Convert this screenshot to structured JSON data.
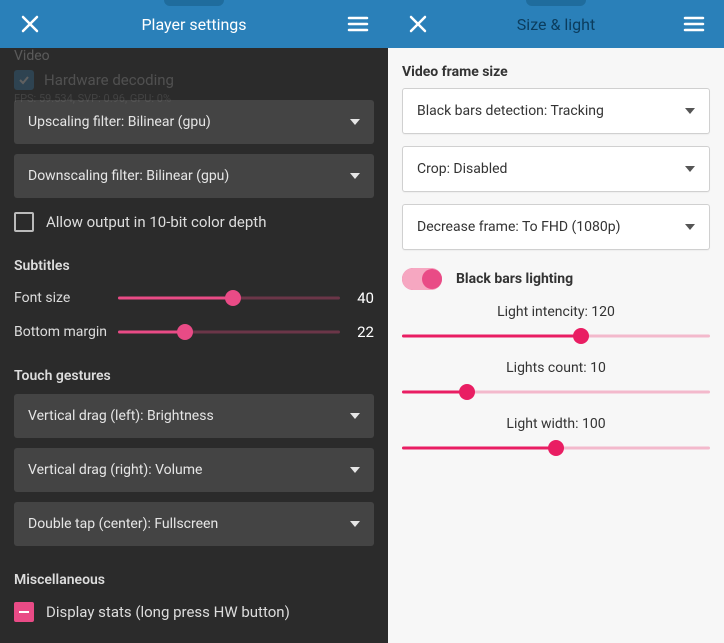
{
  "left": {
    "title": "Player settings",
    "ghost": {
      "section": "Video",
      "hw_decoding": "Hardware decoding",
      "stats": "FPS: 59.534, SVP: 0.96, GPU: 0%"
    },
    "upscaling": "Upscaling filter: Bilinear (gpu)",
    "downscaling": "Downscaling filter: Bilinear (gpu)",
    "allow_10bit": "Allow output in 10-bit color depth",
    "subtitles_title": "Subtitles",
    "font_size_label": "Font size",
    "font_size_value": "40",
    "font_size_pct": 52,
    "bottom_margin_label": "Bottom margin",
    "bottom_margin_value": "22",
    "bottom_margin_pct": 30,
    "touch_title": "Touch gestures",
    "vdrag_left": "Vertical drag (left): Brightness",
    "vdrag_right": "Vertical drag (right): Volume",
    "double_tap": "Double tap (center): Fullscreen",
    "misc_title": "Miscellaneous",
    "display_stats": "Display stats (long press HW button)"
  },
  "right": {
    "title": "Size & light",
    "frame_title": "Video frame size",
    "black_bars": "Black bars detection: Tracking",
    "crop": "Crop: Disabled",
    "decrease": "Decrease frame: To FHD (1080p)",
    "lighting_label": "Black bars lighting",
    "intensity_label": "Light intencity: 120",
    "intensity_pct": 58,
    "count_label": "Lights count: 10",
    "count_pct": 21,
    "width_label": "Light width: 100",
    "width_pct": 50
  }
}
